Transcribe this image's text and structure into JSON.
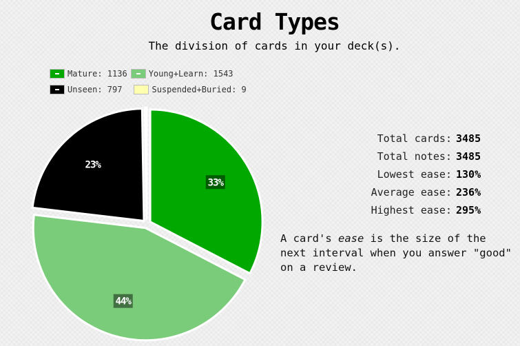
{
  "header": {
    "title": "Card Types",
    "subtitle": "The division of cards in your deck(s)."
  },
  "legend": {
    "items": [
      {
        "label": "Mature: 1136",
        "color": "#00a800"
      },
      {
        "label": "Young+Learn: 1543",
        "color": "#7acc7a"
      },
      {
        "label": "Unseen: 797",
        "color": "#000000"
      },
      {
        "label": "Suspended+Buried: 9",
        "color": "#ffffb0"
      }
    ]
  },
  "stats": {
    "total_cards_label": "Total cards:",
    "total_cards_value": "3485",
    "total_notes_label": "Total notes:",
    "total_notes_value": "3485",
    "lowest_ease_label": "Lowest ease:",
    "lowest_ease_value": "130%",
    "average_ease_label": "Average ease:",
    "average_ease_value": "236%",
    "highest_ease_label": "Highest ease:",
    "highest_ease_value": "295%"
  },
  "note": {
    "prefix": "A card's ",
    "emphasis": "ease",
    "suffix": " is the size of the next interval when you answer \"good\" on a review."
  },
  "chart_data": {
    "type": "pie",
    "title": "Card Types",
    "subtitle": "The division of cards in your deck(s).",
    "legend_placement": "top-left",
    "series": [
      {
        "name": "Mature",
        "value": 1136,
        "label": "33%",
        "color": "#00a800"
      },
      {
        "name": "Young+Learn",
        "value": 1543,
        "label": "44%",
        "color": "#7acc7a"
      },
      {
        "name": "Unseen",
        "value": 797,
        "label": "23%",
        "color": "#000000"
      },
      {
        "name": "Suspended+Buried",
        "value": 9,
        "label": "",
        "color": "#ffffb0"
      }
    ]
  }
}
